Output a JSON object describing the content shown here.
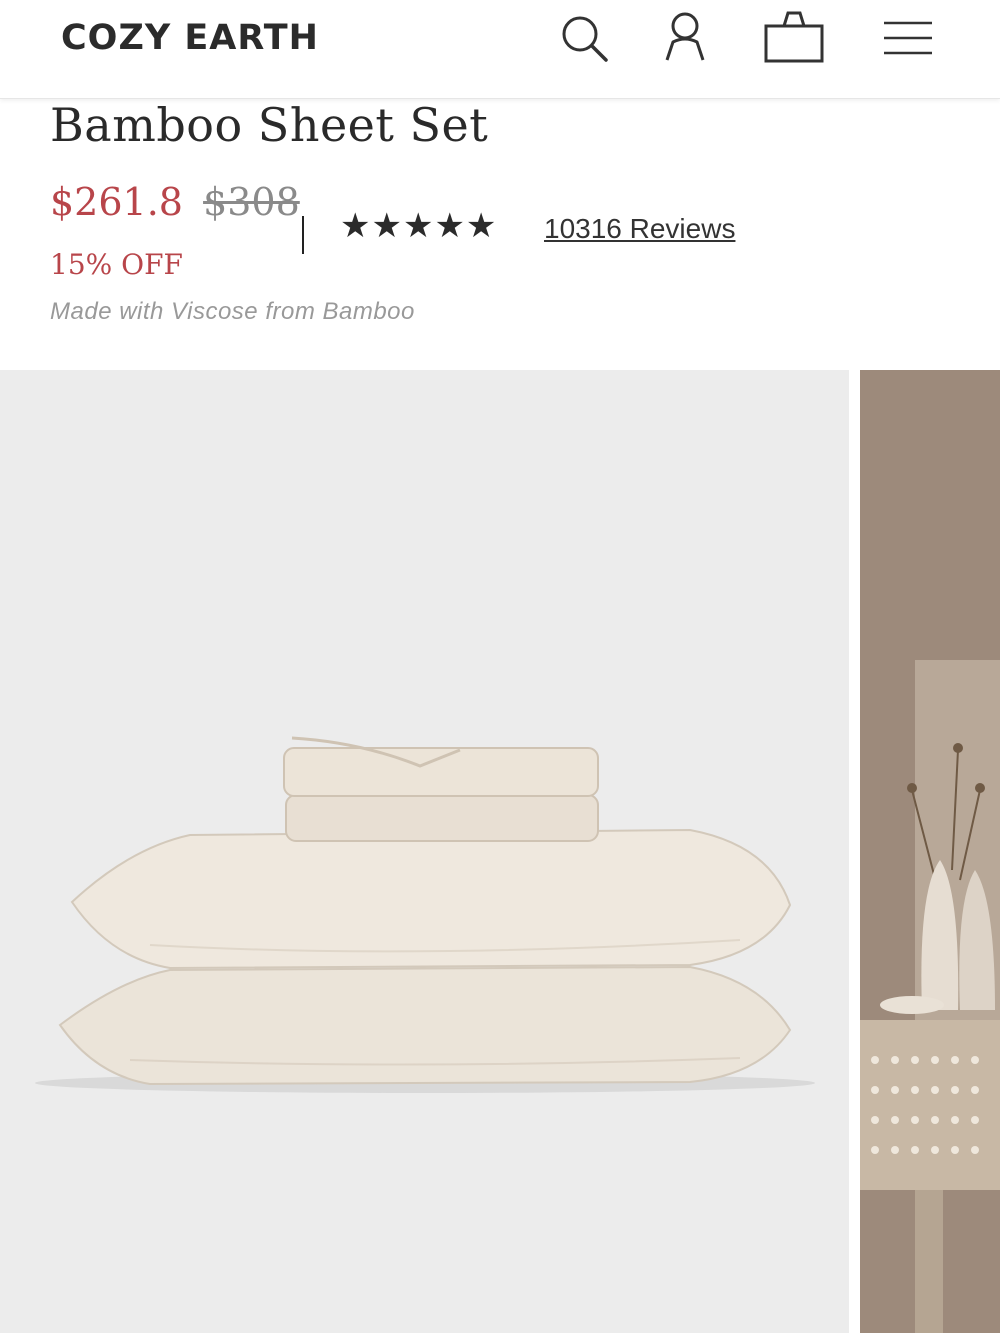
{
  "header": {
    "brand": "COZY EARTH",
    "icons": [
      "search-icon",
      "account-icon",
      "bag-icon",
      "menu-icon"
    ]
  },
  "product": {
    "title": "Bamboo Sheet Set",
    "sale_price": "$261.8",
    "original_price": "$308",
    "discount": "15% OFF",
    "rating_stars": "★★★★★",
    "rating": 5,
    "reviews": "10316 Reviews",
    "material": "Made with Viscose from Bamboo"
  },
  "colors": {
    "sale": "#b8454a",
    "text": "#2a2a2a",
    "muted": "#999999",
    "gallery_bg": "#ececec"
  },
  "gallery": {
    "slides": [
      "folded-sheets-and-pillows-image",
      "bedroom-lifestyle-image"
    ]
  }
}
